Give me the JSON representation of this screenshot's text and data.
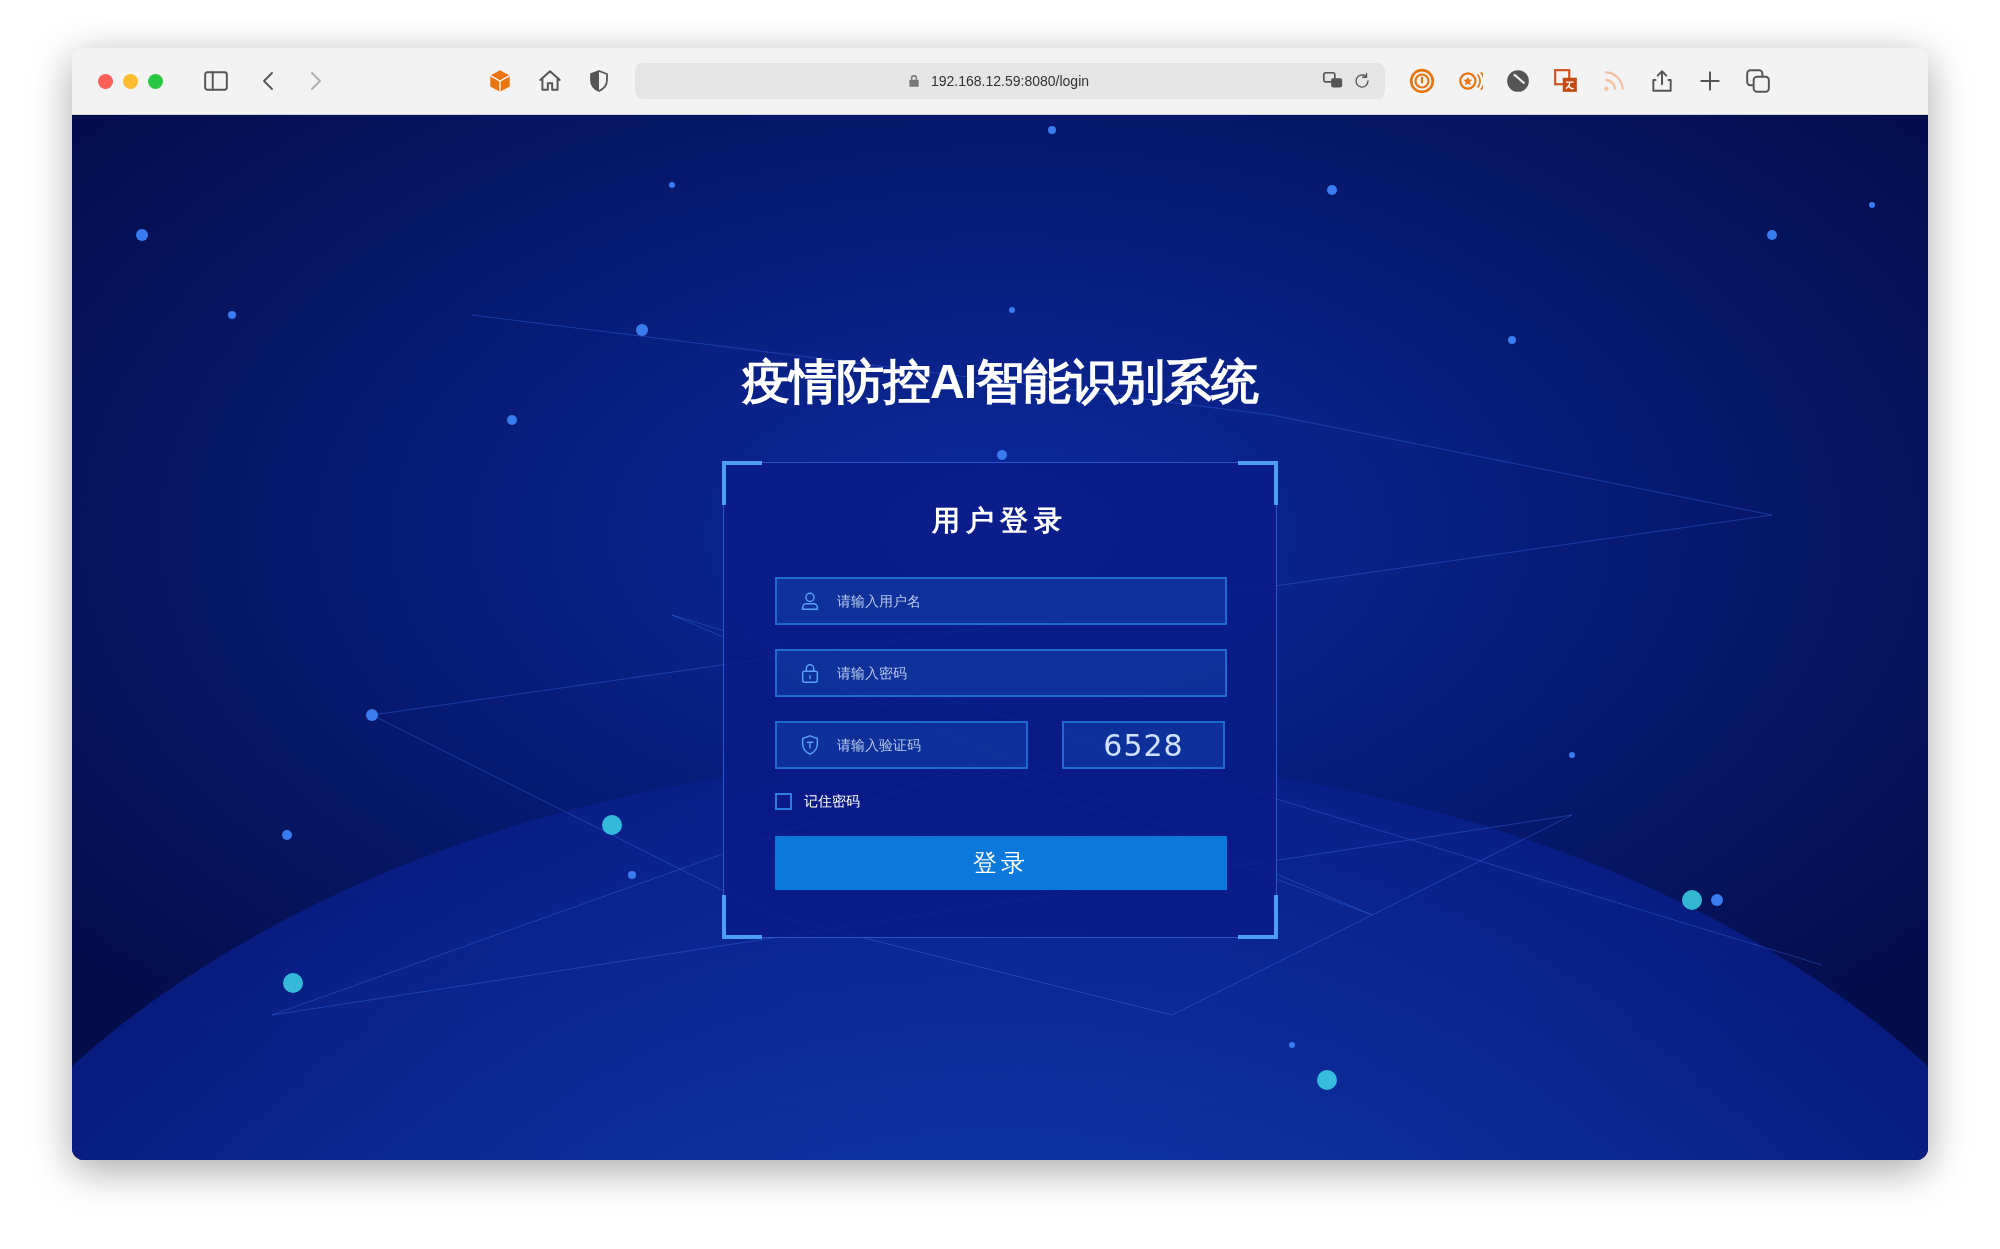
{
  "browser": {
    "url": "192.168.12.59:8080/login"
  },
  "page": {
    "title": "疫情防控AI智能识别系统"
  },
  "login": {
    "heading": "用户登录",
    "fields": [
      {
        "kind": "user",
        "placeholder": "请输入用户名"
      },
      {
        "kind": "password",
        "placeholder": "请输入密码"
      }
    ],
    "captcha": {
      "placeholder": "请输入验证码",
      "code": "6528"
    },
    "remember": {
      "label": "记住密码",
      "checked": false
    },
    "submit": "登录"
  }
}
